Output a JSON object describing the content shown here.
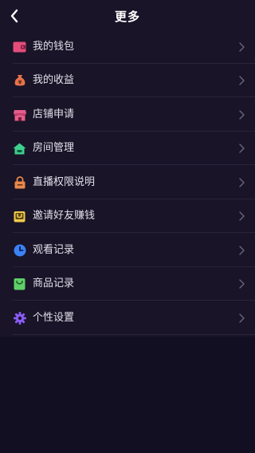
{
  "header": {
    "title": "更多",
    "back_icon": "chevron-left-icon"
  },
  "menu": {
    "items": [
      {
        "label": "我的钱包",
        "icon": "wallet-icon",
        "color": "#e44d7b"
      },
      {
        "label": "我的收益",
        "icon": "money-bag-icon",
        "color": "#e8734a"
      },
      {
        "label": "店铺申请",
        "icon": "store-icon",
        "color": "#e45d8a"
      },
      {
        "label": "房间管理",
        "icon": "house-icon",
        "color": "#3ecf8e"
      },
      {
        "label": "直播权限说明",
        "icon": "lock-icon",
        "color": "#e8894a"
      },
      {
        "label": "邀请好友赚钱",
        "icon": "gift-bag-icon",
        "color": "#f2c94c"
      },
      {
        "label": "观看记录",
        "icon": "clock-icon",
        "color": "#3b82f6"
      },
      {
        "label": "商品记录",
        "icon": "shopping-bag-icon",
        "color": "#5fd068"
      },
      {
        "label": "个性设置",
        "icon": "gear-icon",
        "color": "#8b5cf6"
      }
    ]
  },
  "colors": {
    "background": "#130f22",
    "panel": "#191428",
    "chevron": "#6b6680"
  }
}
